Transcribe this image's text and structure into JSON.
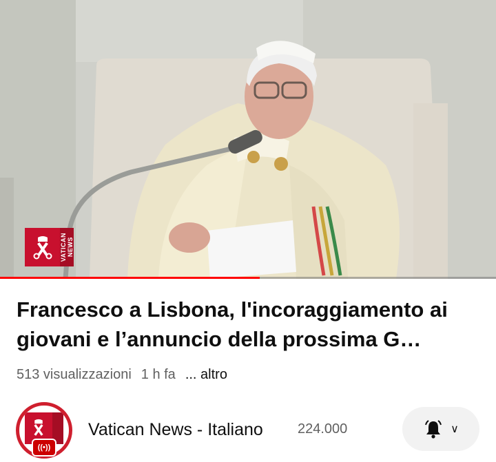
{
  "video": {
    "progress_fraction": 0.523,
    "watermark": {
      "brand_text": "VATICAN\nNEWS",
      "icon": "keys-of-peter-seal-icon"
    }
  },
  "title": "Francesco a Lisbona, l'incoraggiamento ai giovani e l’annuncio della prossima G…",
  "meta": {
    "views": "513 visualizzazioni",
    "age": "1 h fa",
    "more": "... altro"
  },
  "channel": {
    "name": "Vatican News - Italiano",
    "subscribers": "224.000",
    "avatar_icon": "vatican-news-logo-icon",
    "live_icon": "live-broadcast-icon",
    "live_glyph": "((•))"
  },
  "notifications": {
    "bell_icon": "bell-ringing-icon",
    "chevron_icon": "chevron-down-icon",
    "chevron_glyph": "∨"
  },
  "colors": {
    "progress": "#ff0000",
    "brand_red": "#c8102e",
    "text_secondary": "#606060"
  }
}
